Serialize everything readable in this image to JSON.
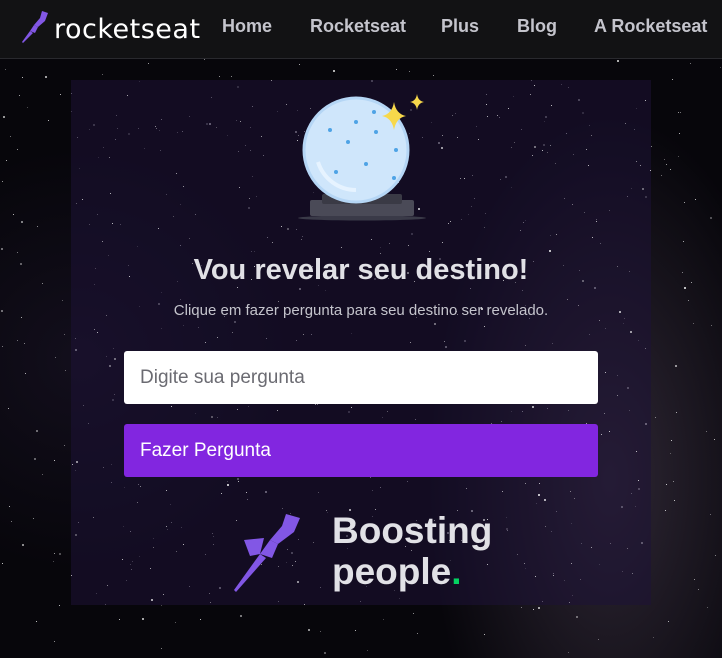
{
  "nav": {
    "brand": "rocketseat",
    "links": [
      "Home",
      "Rocketseat",
      "Plus",
      "Blog",
      "A Rocketseat"
    ]
  },
  "main": {
    "title": "Vou revelar seu destino!",
    "subtitle": "Clique em fazer pergunta para seu destino ser revelado.",
    "question_placeholder": "Digite sua pergunta",
    "question_value": "",
    "ask_button": "Fazer Pergunta"
  },
  "footer_logo": {
    "line1": "Boosting",
    "line2": "people",
    "dot": "."
  },
  "colors": {
    "accent": "#8226e0",
    "nav_bg": "#121214",
    "green_dot": "#04d361"
  },
  "icons": [
    "rocketseat-logo-icon",
    "crystal-ball-icon",
    "sparkle-icon",
    "rocket-icon"
  ]
}
